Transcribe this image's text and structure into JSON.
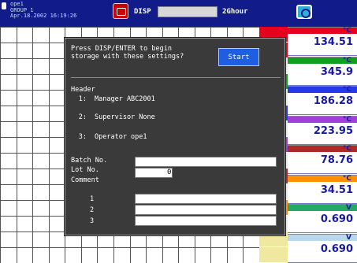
{
  "status": {
    "info_lines": [
      "ope1",
      "GROUP 1",
      "Apr.18.2002 16:19:26"
    ],
    "display_label": "DISP",
    "rate": "2Ghour",
    "rec_icon": "record-icon",
    "media_icon": "media-disk-icon"
  },
  "channels": [
    {
      "color": "#e6001e",
      "unit": "°C",
      "value": "134.51"
    },
    {
      "color": "#10a020",
      "unit": "°C",
      "value": "345.9"
    },
    {
      "color": "#2838e8",
      "unit": "°C",
      "value": "186.28"
    },
    {
      "color": "#a040d8",
      "unit": "°C",
      "value": "223.95"
    },
    {
      "color": "#b02828",
      "unit": "°C",
      "value": "78.76"
    },
    {
      "color": "#ff9000",
      "unit": "°C",
      "value": "34.51"
    },
    {
      "color": "#28a868",
      "unit": "V",
      "value": "0.690"
    },
    {
      "color": "#b8d8f0",
      "unit": "V",
      "value": "0.690"
    }
  ],
  "dialog": {
    "title_line1": "Press DISP/ENTER to begin",
    "title_line2": "storage with these settings?",
    "start_label": "Start",
    "header_label": "Header",
    "headers": [
      {
        "num": "1:",
        "text": "Manager ABC2001"
      },
      {
        "num": "2:",
        "text": "Supervisor None"
      },
      {
        "num": "3:",
        "text": "Operator ope1"
      }
    ],
    "batch_label": "Batch No.",
    "batch_value": "",
    "lot_label": "Lot No.",
    "lot_value": "0",
    "comment_label": "Comment",
    "comments": [
      {
        "num": "1",
        "value": ""
      },
      {
        "num": "2",
        "value": ""
      },
      {
        "num": "3",
        "value": ""
      }
    ]
  }
}
